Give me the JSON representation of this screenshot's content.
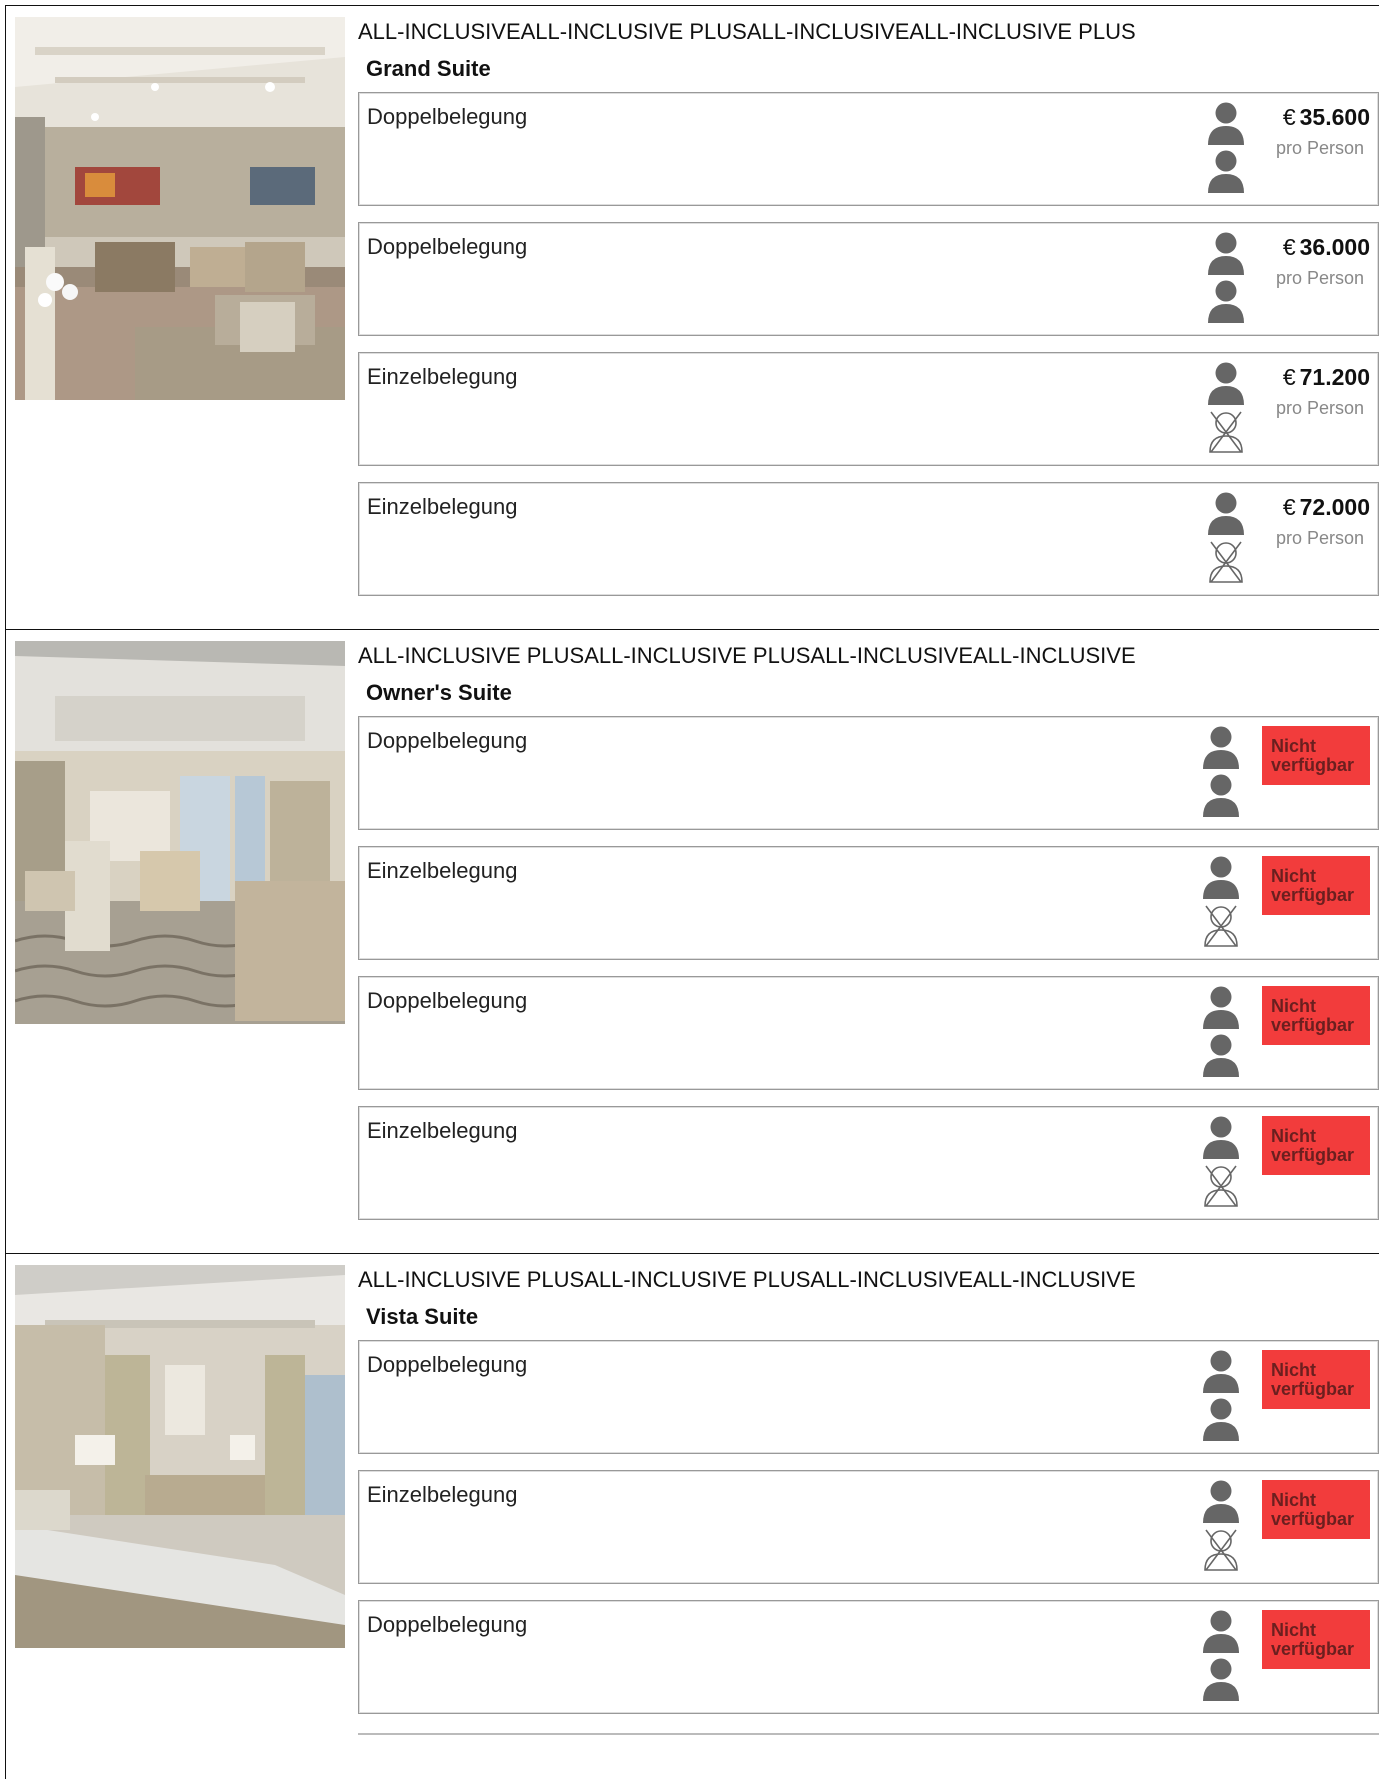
{
  "labels": {
    "per_person": "pro Person",
    "not_available": "Nicht verfügbar",
    "currency": "€"
  },
  "icons": {
    "occupied": "person-icon",
    "empty": "crossed-person-icon"
  },
  "suites": [
    {
      "packages": "ALL-INCLUSIVEALL-INCLUSIVE PLUSALL-INCLUSIVEALL-INCLUSIVE PLUS",
      "name": "Grand Suite",
      "options": [
        {
          "label": "Doppelbelegung",
          "price": "35.600",
          "guests": 2
        },
        {
          "label": "Doppelbelegung",
          "price": "36.000",
          "guests": 2
        },
        {
          "label": "Einzelbelegung",
          "price": "71.200",
          "guests": 1
        },
        {
          "label": "Einzelbelegung",
          "price": "72.000",
          "guests": 1
        }
      ]
    },
    {
      "packages": "ALL-INCLUSIVE PLUSALL-INCLUSIVE PLUSALL-INCLUSIVEALL-INCLUSIVE",
      "name": "Owner's Suite",
      "options": [
        {
          "label": "Doppelbelegung",
          "status": "Nicht verfügbar",
          "guests": 2
        },
        {
          "label": "Einzelbelegung",
          "status": "Nicht verfügbar",
          "guests": 1
        },
        {
          "label": "Doppelbelegung",
          "status": "Nicht verfügbar",
          "guests": 2
        },
        {
          "label": "Einzelbelegung",
          "status": "Nicht verfügbar",
          "guests": 1
        }
      ]
    },
    {
      "packages": "ALL-INCLUSIVE PLUSALL-INCLUSIVE PLUSALL-INCLUSIVEALL-INCLUSIVE",
      "name": "Vista Suite",
      "options": [
        {
          "label": "Doppelbelegung",
          "status": "Nicht verfügbar",
          "guests": 2
        },
        {
          "label": "Einzelbelegung",
          "status": "Nicht verfügbar",
          "guests": 1
        },
        {
          "label": "Doppelbelegung",
          "status": "Nicht verfügbar",
          "guests": 2
        }
      ]
    }
  ]
}
